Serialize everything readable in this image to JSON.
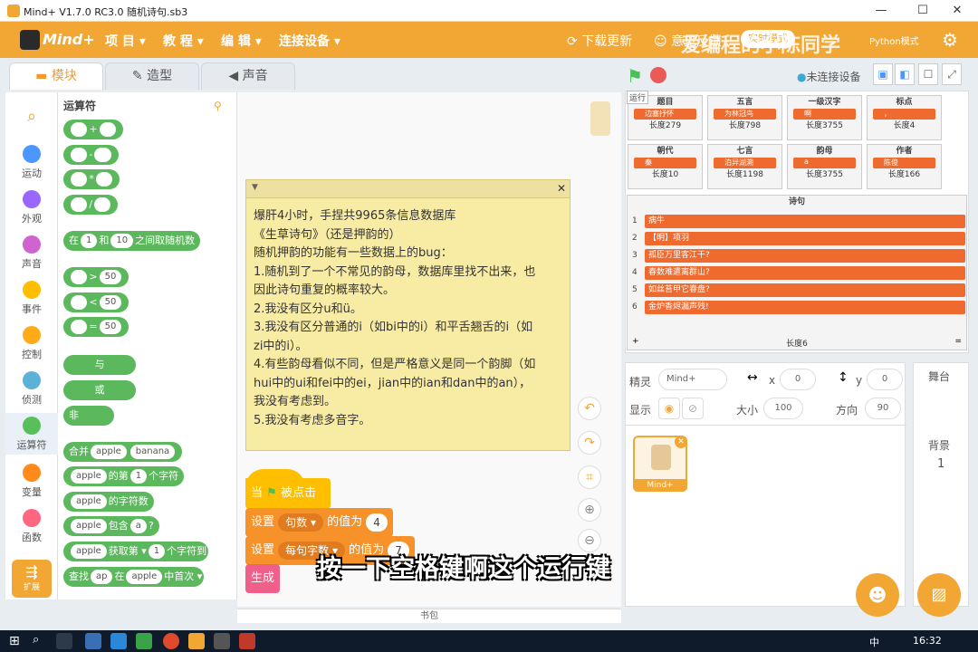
{
  "window": {
    "title": "Mind+ V1.7.0 RC3.0   随机诗句.sb3",
    "min": "—",
    "max": "☐",
    "close": "✕"
  },
  "menu": {
    "logo": "Mind+",
    "items": [
      "项 目 ▾",
      "教 程 ▾",
      "编 辑 ▾",
      "连接设备 ▾"
    ],
    "download": "下载更新",
    "feedback": "意见反馈",
    "mode": "实时模式",
    "python": "Python模式"
  },
  "watermark": "爱编程的小陈同学",
  "tabs": {
    "code": "模块",
    "costume": "造型",
    "sound": "声音"
  },
  "categories": [
    {
      "label": "运动",
      "color": "#4c97ff"
    },
    {
      "label": "外观",
      "color": "#9966ff"
    },
    {
      "label": "声音",
      "color": "#cf63cf"
    },
    {
      "label": "事件",
      "color": "#ffbf00"
    },
    {
      "label": "控制",
      "color": "#ffab19"
    },
    {
      "label": "侦测",
      "color": "#5cb1d6"
    },
    {
      "label": "运算符",
      "color": "#59c059"
    },
    {
      "label": "变量",
      "color": "#ff8c1a"
    },
    {
      "label": "函数",
      "color": "#ff6680"
    }
  ],
  "ext_label": "扩展",
  "palette": {
    "title": "运算符",
    "blocks": {
      "add": "+",
      "sub": "-",
      "mul": "*",
      "div": "/",
      "rand_pre": "在",
      "rand_a": "1",
      "rand_mid": "和",
      "rand_b": "10",
      "rand_post": "之间取随机数",
      "gt": ">",
      "lt": "<",
      "eq": "=",
      "cmp_val": "50",
      "and": "与",
      "or": "或",
      "not": "非",
      "join": "合并",
      "join_a": "apple",
      "join_b": "banana",
      "letter_a": "apple",
      "letter_mid": "的第",
      "letter_n": "1",
      "letter_post": "个字符",
      "len_a": "apple",
      "len_post": "的字符数",
      "contains_a": "apple",
      "contains_mid": "包含",
      "contains_b": "a",
      "contains_post": "?",
      "get_a": "apple",
      "get_mid": "获取",
      "get_dir": "第 ▾",
      "get_n": "1",
      "get_post": "个字符到",
      "find_pre": "查找",
      "find_a": "ap",
      "find_mid": "在",
      "find_b": "apple",
      "find_mid2": "中",
      "find_dir": "首次 ▾"
    }
  },
  "note": {
    "lines": [
      "爆肝4小时，手捏共9965条信息数据库",
      "《生草诗句》（还是押韵的）",
      "随机押韵的功能有一些数据上的bug：",
      "1.随机到了一个不常见的韵母，数据库里找不出来，也",
      "因此诗句重复的概率较大。",
      "2.我没有区分u和ü。",
      "3.我没有区分普通的i（如bi中的i）和平舌翘舌的i（如",
      "zi中的i）。",
      "4.有些韵母看似不同，但是严格意义是同一个韵脚（如",
      "hui中的ui和fei中的ei，jian中的ian和dan中的an），",
      "我没有考虑到。",
      "5.我没有考虑多音字。"
    ]
  },
  "script": {
    "hat_pre": "当",
    "hat_post": "被点击",
    "set1_pre": "设置",
    "set1_var": "句数 ▾",
    "set1_mid": "的值为",
    "set1_val": "4",
    "set2_pre": "设置",
    "set2_var": "每句字数 ▾",
    "set2_mid": "的值为",
    "set2_val": "7",
    "gen": "生成"
  },
  "subtitle": "按一下空格键啊这个运行键",
  "backpack": "书包",
  "stage": {
    "run_label": "运行",
    "not_connected": "未连接设备",
    "vars": [
      {
        "title": "题目",
        "item": "边塞抒怀",
        "len": "长度279"
      },
      {
        "title": "五言",
        "item": "为林冠鸟",
        "len": "长度798"
      },
      {
        "title": "一级汉字",
        "item": "啊",
        "len": "长度3755"
      },
      {
        "title": "标点",
        "item": "，",
        "len": "长度4"
      },
      {
        "title": "朝代",
        "item": "秦",
        "len": "长度10"
      },
      {
        "title": "七言",
        "item": "泊异湖溯",
        "len": "长度1198"
      },
      {
        "title": "韵母",
        "item": "a",
        "len": "长度3755"
      },
      {
        "title": "作者",
        "item": "陈俊",
        "len": "长度166"
      }
    ],
    "list": {
      "title": "诗句",
      "rows": [
        "病牛",
        "【明】项羽",
        "孤臣万里客江干?",
        "春数难遣离群山?",
        "如丝苔甲它春盘?",
        "金炉香烬漏声残!"
      ],
      "len": "长度6"
    }
  },
  "sprite": {
    "label": "精灵",
    "name": "Mind+",
    "x_label": "x",
    "x": "0",
    "y_label": "y",
    "y": "0",
    "show_label": "显示",
    "size_label": "大小",
    "size": "100",
    "dir_label": "方向",
    "dir": "90",
    "thumb": "Mind+"
  },
  "stage_panel": {
    "title": "舞台",
    "bg_label": "背景",
    "bg_count": "1"
  },
  "taskbar": {
    "time": "16:32",
    "ime": "中"
  }
}
